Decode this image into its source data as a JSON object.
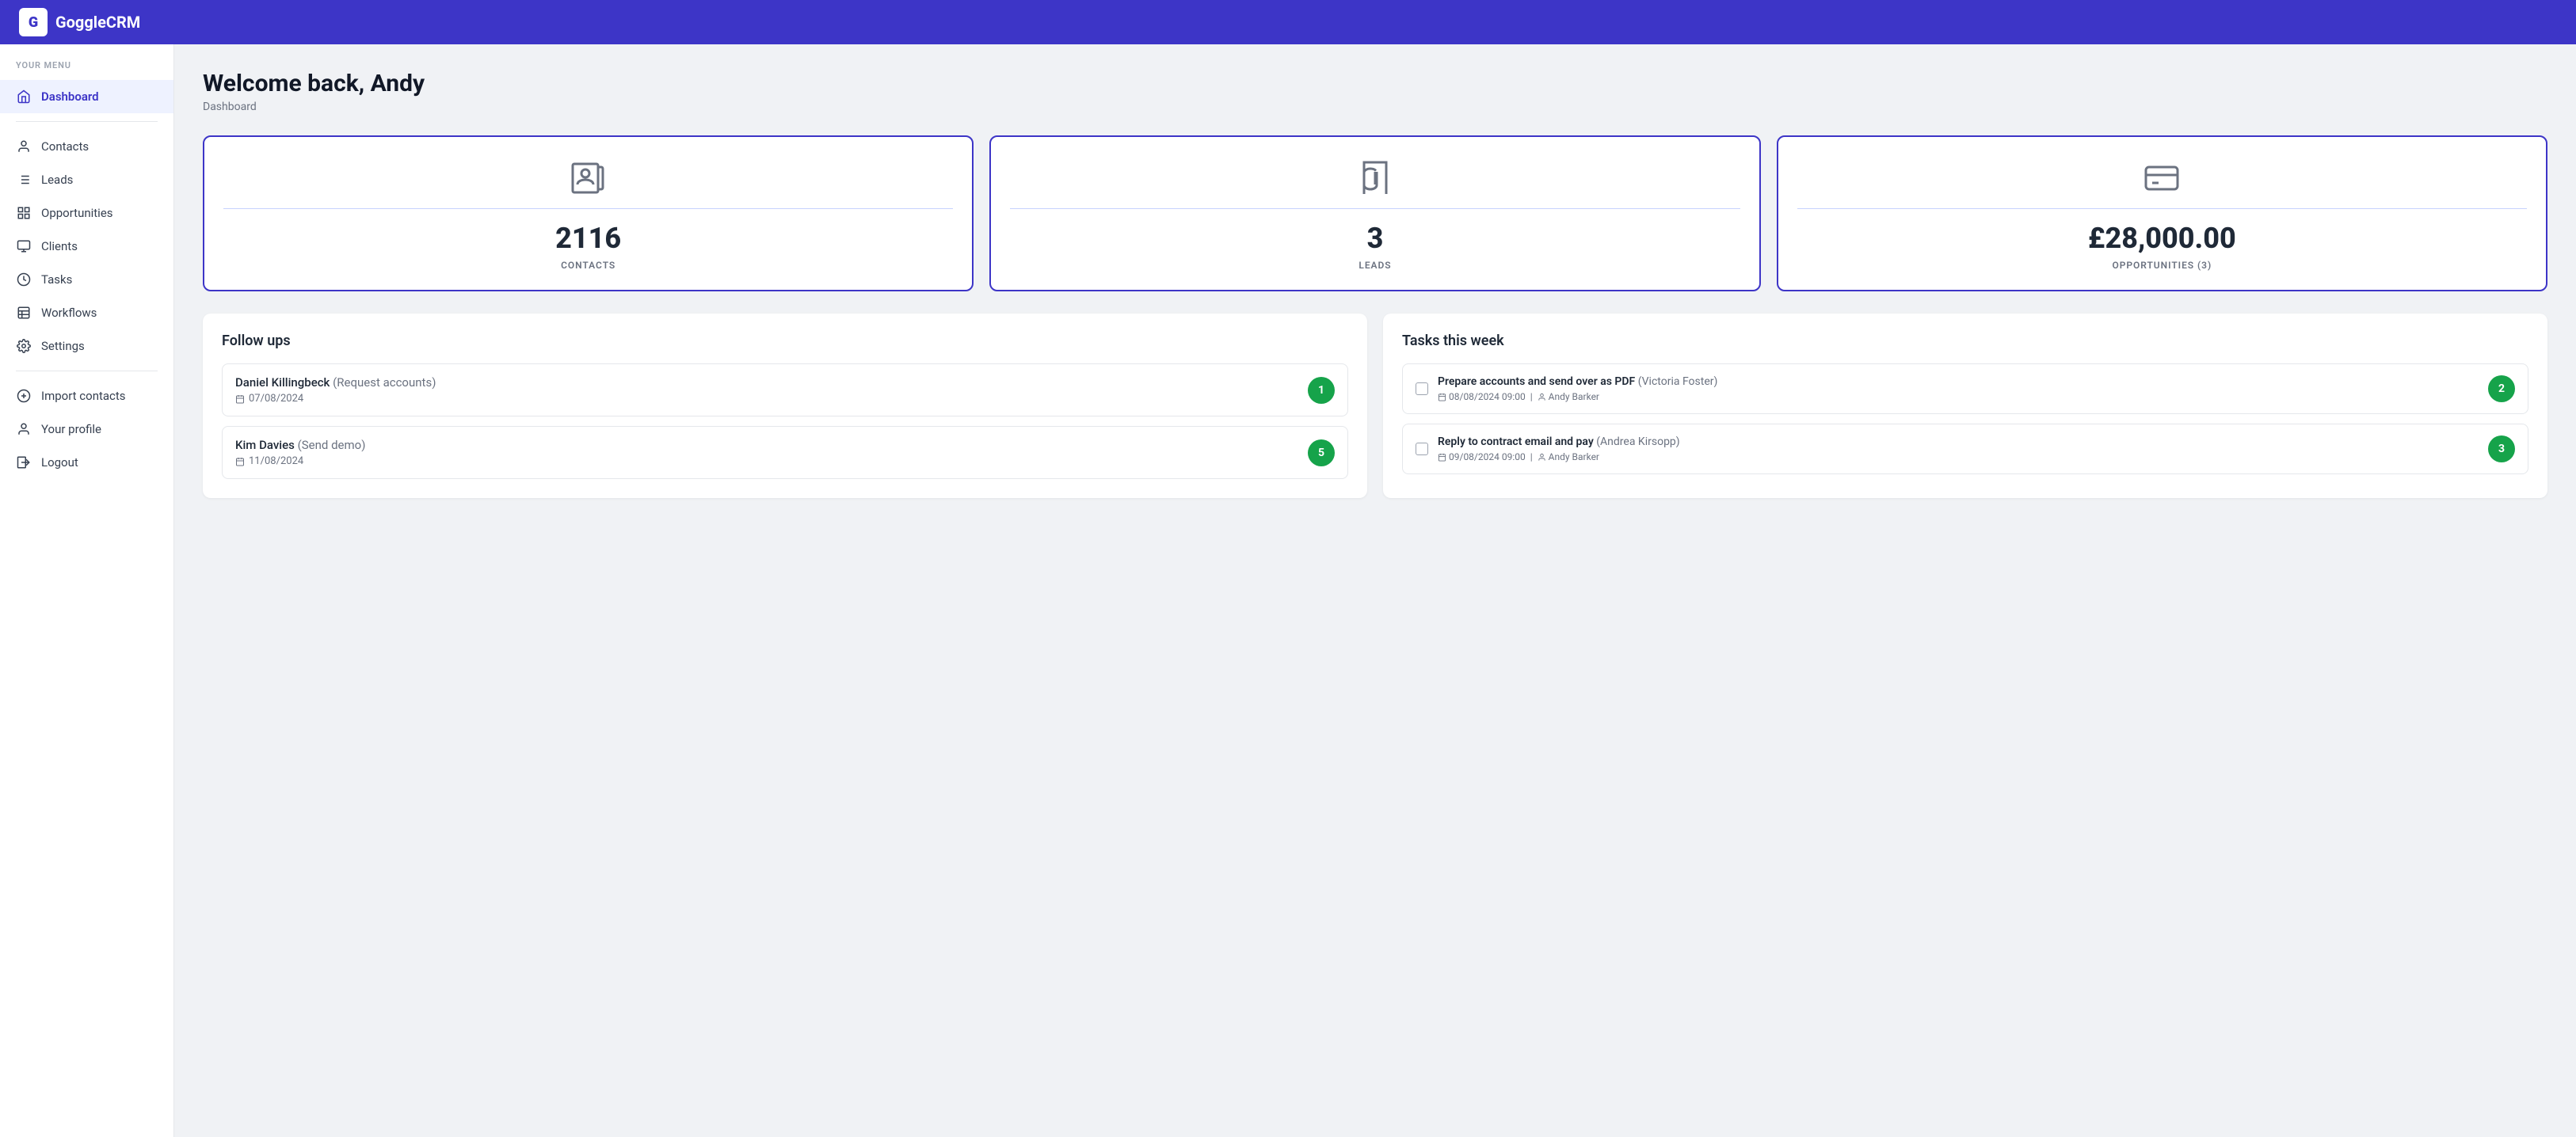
{
  "app": {
    "name": "GoggleCRM",
    "logo_letter": "G"
  },
  "sidebar": {
    "section_label": "YOUR MENU",
    "items": [
      {
        "id": "dashboard",
        "label": "Dashboard",
        "active": true
      },
      {
        "id": "contacts",
        "label": "Contacts",
        "active": false
      },
      {
        "id": "leads",
        "label": "Leads",
        "active": false
      },
      {
        "id": "opportunities",
        "label": "Opportunities",
        "active": false
      },
      {
        "id": "clients",
        "label": "Clients",
        "active": false
      },
      {
        "id": "tasks",
        "label": "Tasks",
        "active": false
      },
      {
        "id": "workflows",
        "label": "Workflows",
        "active": false
      },
      {
        "id": "settings",
        "label": "Settings",
        "active": false
      }
    ],
    "secondary_items": [
      {
        "id": "import-contacts",
        "label": "Import contacts"
      },
      {
        "id": "your-profile",
        "label": "Your profile"
      },
      {
        "id": "logout",
        "label": "Logout"
      }
    ]
  },
  "header": {
    "welcome": "Welcome back, Andy",
    "breadcrumb": "Dashboard"
  },
  "stat_cards": [
    {
      "id": "contacts-card",
      "value": "2116",
      "label": "CONTACTS",
      "icon": "contacts-icon"
    },
    {
      "id": "leads-card",
      "value": "3",
      "label": "LEADS",
      "icon": "hourglass-icon"
    },
    {
      "id": "opportunities-card",
      "value": "£28,000.00",
      "label": "OPPORTUNITIES (3)",
      "icon": "card-icon"
    }
  ],
  "followups": {
    "title": "Follow ups",
    "items": [
      {
        "id": "followup-1",
        "name": "Daniel Killingbeck",
        "action": "(Request accounts)",
        "date": "07/08/2024",
        "badge": "1"
      },
      {
        "id": "followup-2",
        "name": "Kim Davies",
        "action": "(Send demo)",
        "date": "11/08/2024",
        "badge": "5"
      }
    ]
  },
  "tasks": {
    "title": "Tasks this week",
    "items": [
      {
        "id": "task-1",
        "name": "Prepare accounts and send over as PDF",
        "contact": "(Victoria Foster)",
        "date": "08/08/2024 09:00",
        "assigned": "Andy Barker",
        "badge": "2"
      },
      {
        "id": "task-2",
        "name": "Reply to contract email and pay",
        "contact": "(Andrea Kirsopp)",
        "date": "09/08/2024 09:00",
        "assigned": "Andy Barker",
        "badge": "3"
      }
    ]
  }
}
